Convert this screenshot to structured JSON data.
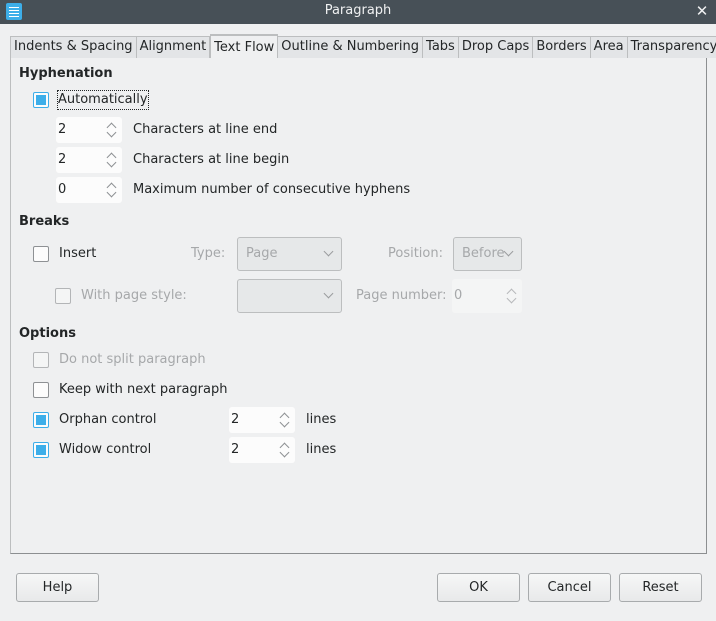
{
  "window": {
    "title": "Paragraph",
    "close_glyph": "✕",
    "app_icon": "writer-document-icon"
  },
  "tabs": [
    {
      "label": "Indents & Spacing"
    },
    {
      "label": "Alignment"
    },
    {
      "label": "Text Flow",
      "active": true
    },
    {
      "label": "Outline & Numbering"
    },
    {
      "label": "Tabs"
    },
    {
      "label": "Drop Caps"
    },
    {
      "label": "Borders"
    },
    {
      "label": "Area"
    },
    {
      "label": "Transparency"
    }
  ],
  "hyphenation": {
    "title": "Hyphenation",
    "automatically": {
      "label": "Automatically",
      "checked": true
    },
    "chars_line_end": {
      "value": "2",
      "label": "Characters at line end"
    },
    "chars_line_begin": {
      "value": "2",
      "label": "Characters at line begin"
    },
    "max_hyphens": {
      "value": "0",
      "label": "Maximum number of consecutive hyphens"
    }
  },
  "breaks": {
    "title": "Breaks",
    "insert": {
      "label": "Insert",
      "checked": false
    },
    "type_label": "Type:",
    "type_value": "Page",
    "position_label": "Position:",
    "position_value": "Before",
    "with_page_style": {
      "label": "With page style:",
      "checked": false
    },
    "page_style_value": "",
    "page_number_label": "Page number:",
    "page_number_value": "0"
  },
  "options": {
    "title": "Options",
    "do_not_split": {
      "label": "Do not split paragraph",
      "checked": false
    },
    "keep_with_next": {
      "label": "Keep with next paragraph",
      "checked": false
    },
    "orphan": {
      "label": "Orphan control",
      "checked": true,
      "value": "2",
      "unit": "lines"
    },
    "widow": {
      "label": "Widow control",
      "checked": true,
      "value": "2",
      "unit": "lines"
    }
  },
  "footer": {
    "help": "Help",
    "ok": "OK",
    "cancel": "Cancel",
    "reset": "Reset"
  },
  "colors": {
    "accent": "#3daee9",
    "titlebar": "#475057",
    "background": "#eff0f1"
  }
}
